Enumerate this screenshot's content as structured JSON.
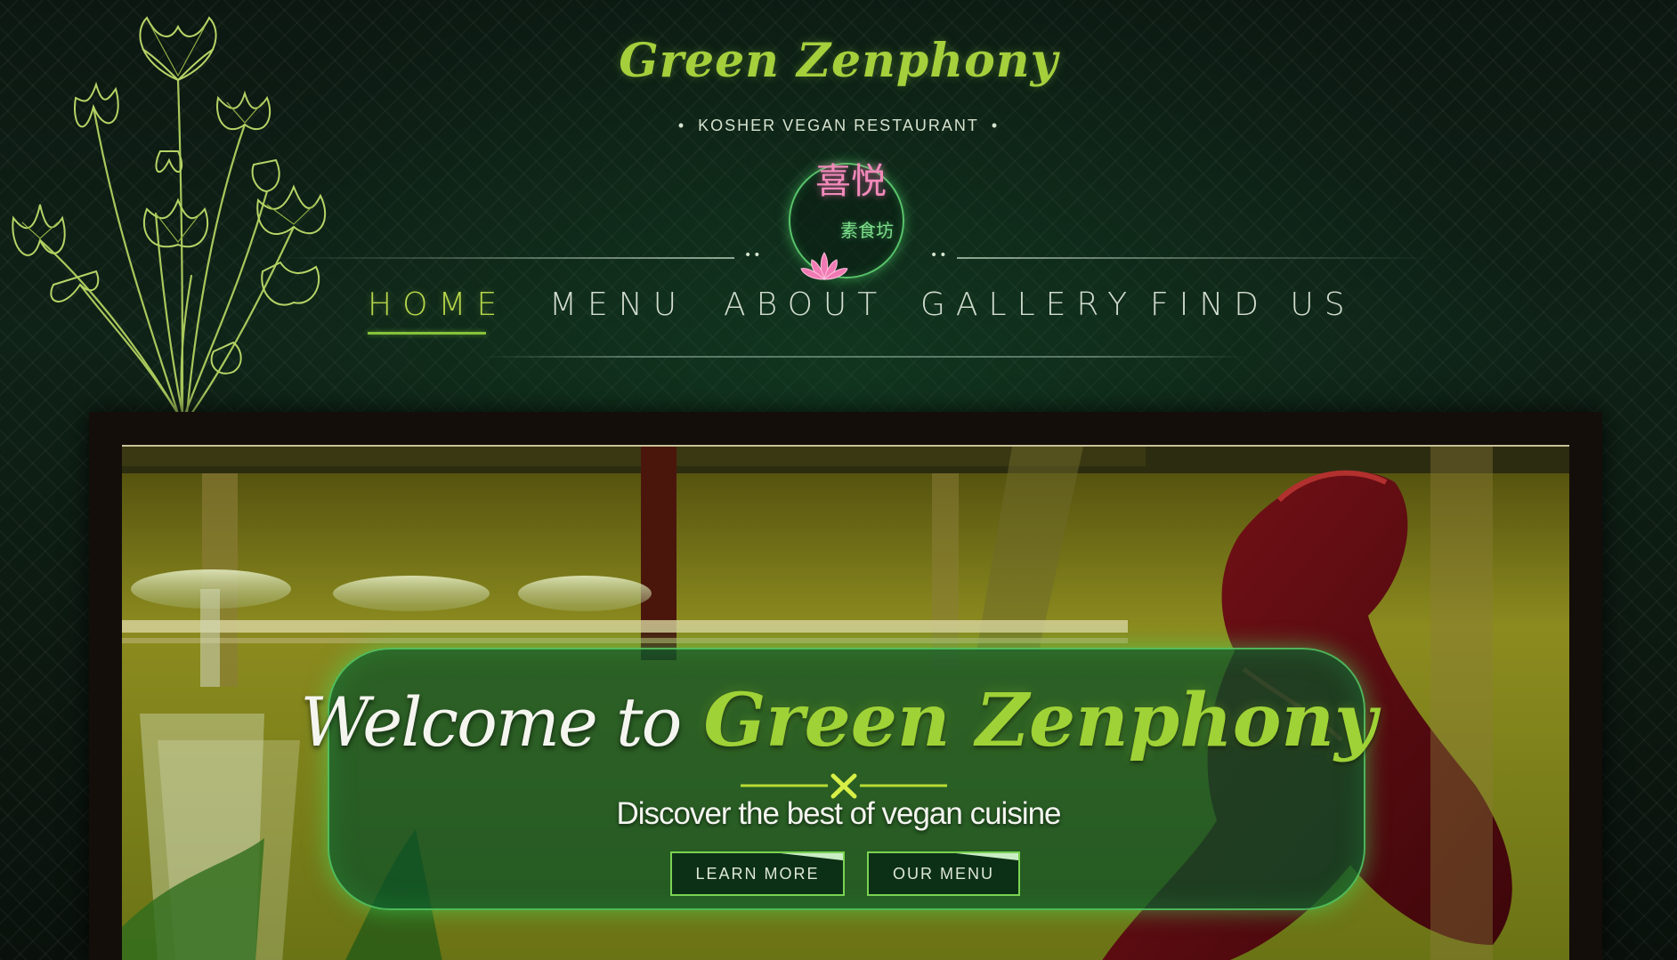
{
  "site": {
    "name": "Green Zenphony",
    "tagline": "KOSHER  VEGAN  RESTAURANT",
    "tagline_bullet": "•",
    "logo_text_large": "喜悦",
    "logo_text_small": "素食坊"
  },
  "nav": {
    "items": [
      {
        "label": "HOME",
        "active": true
      },
      {
        "label": "MENU",
        "active": false
      },
      {
        "label": "ABOUT",
        "active": false
      },
      {
        "label": "GALLERY",
        "active": false
      },
      {
        "label": "FIND US",
        "active": false
      }
    ]
  },
  "hero": {
    "welcome": "Welcome to",
    "brand": "Green Zenphony",
    "subtitle": "Discover the best of vegan cuisine",
    "buttons": {
      "learn_more": "LEARN MORE",
      "our_menu": "OUR MENU"
    }
  },
  "colors": {
    "brand_green": "#a6cf3c",
    "glow_green": "#58c36a",
    "logo_pink": "#f189b9"
  },
  "icons": {
    "divider_icon": "crossed-utensils-icon",
    "emblem_icon": "lotus-icon",
    "decor_icon": "lotus-bouquet-icon"
  }
}
